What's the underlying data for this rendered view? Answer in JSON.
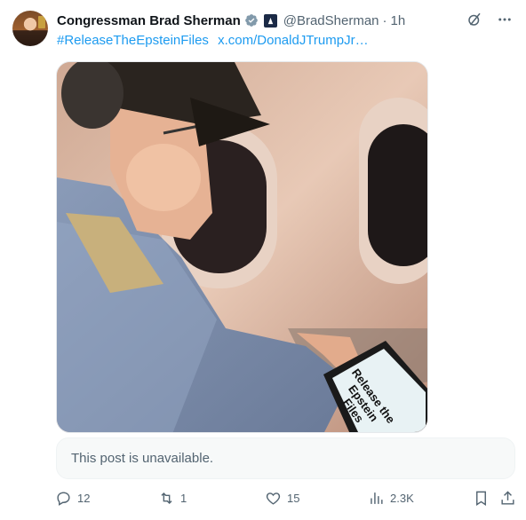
{
  "author": {
    "name": "Congressman Brad Sherman",
    "handle": "@BradSherman",
    "separator": "·",
    "time": "1h"
  },
  "post": {
    "hashtag": "#ReleaseTheEpsteinFiles",
    "link": "x.com/DonaldJTrumpJr…",
    "image_text": "Release the Epstein Files",
    "quoted_unavailable": "This post is unavailable."
  },
  "metrics": {
    "replies": "12",
    "reposts": "1",
    "likes": "15",
    "views": "2.3K"
  },
  "colors": {
    "link": "#1d9bf0",
    "muted": "#536471",
    "text": "#0f1419"
  },
  "icons": [
    "verified-icon",
    "government-badge-icon",
    "grok-icon",
    "more-icon",
    "reply-icon",
    "repost-icon",
    "like-icon",
    "views-icon",
    "bookmark-icon",
    "share-icon"
  ]
}
